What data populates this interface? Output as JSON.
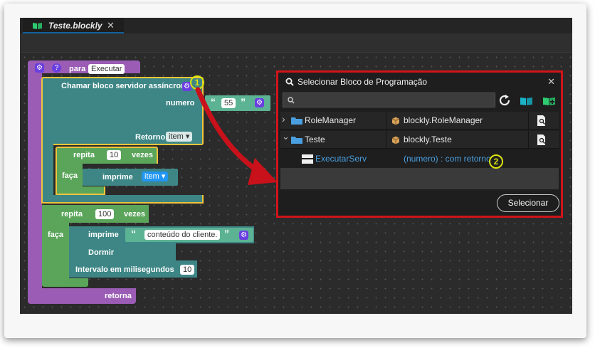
{
  "editor": {
    "tab": {
      "title": "Teste.blockly",
      "close": "✕"
    }
  },
  "blocks": {
    "procedure": {
      "label": "para",
      "name": "Executar",
      "return_label": "retorna",
      "help": "?"
    },
    "call_async": {
      "label": "Chamar bloco servidor assíncrono",
      "param_label": "numero",
      "param_value": "55",
      "return_label": "Retorno",
      "return_var": "item"
    },
    "inner_repeat": {
      "label": "repita",
      "times": "10",
      "unit": "vezes",
      "do_label": "faça"
    },
    "inner_print": {
      "label": "imprime",
      "var": "item"
    },
    "outer_repeat": {
      "label": "repita",
      "times": "100",
      "unit": "vezes",
      "do_label": "faça"
    },
    "outer_print": {
      "label": "imprime",
      "text": "conteúdo do cliente."
    },
    "sleep": {
      "label": "Dormir",
      "interval_label": "Intervalo em milisegundos",
      "interval_value": "10"
    },
    "quote_open": "“",
    "quote_close": "”",
    "dropdown_arrow": "▾"
  },
  "annotations": {
    "one": "1",
    "two": "2"
  },
  "dialog": {
    "title": "Selecionar Bloco de Programação",
    "close": "✕",
    "search_placeholder": "",
    "rows": [
      {
        "name": "RoleManager",
        "module": "blockly.RoleManager",
        "chevron": "›"
      },
      {
        "name": "Teste",
        "module": "blockly.Teste",
        "chevron": "⌄"
      }
    ],
    "child": {
      "name": "ExecutarServ",
      "signature": "(numero) : com retorno"
    },
    "select_button": "Selecionar"
  },
  "colors": {
    "procedure": "#9a5cb4",
    "call_block": "#3e8686",
    "outline": "#f0c43c",
    "loop": "#5ba55b",
    "var_block": "#2196f3",
    "dialog_border": "#d0141a",
    "link": "#4a9fe0"
  }
}
